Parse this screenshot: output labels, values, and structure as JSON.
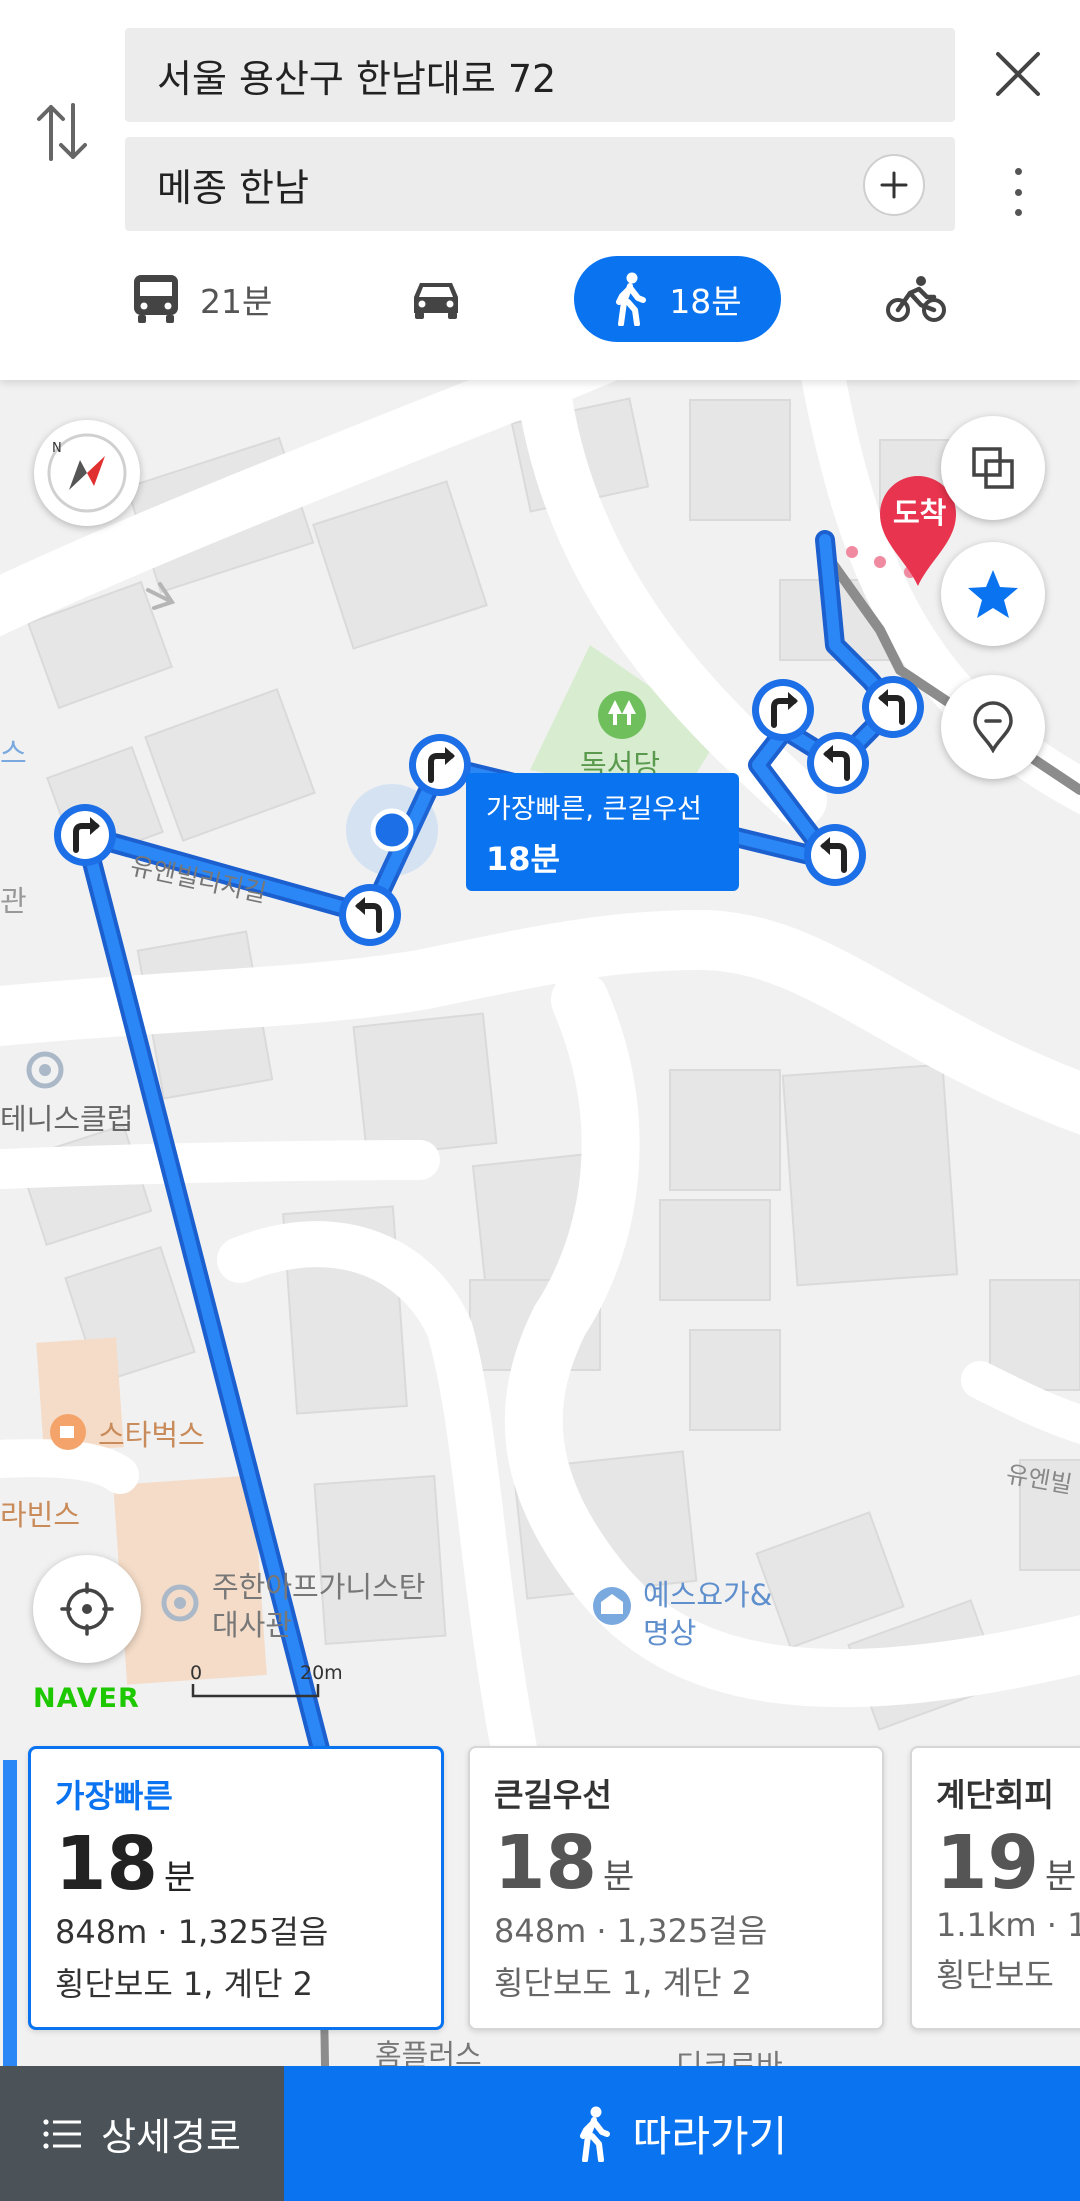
{
  "header": {
    "origin": "서울 용산구 한남대로 72",
    "destination": "메종 한남",
    "modes": [
      {
        "name": "bus",
        "label": "21분",
        "icon": "bus-icon"
      },
      {
        "name": "car",
        "label": "",
        "icon": "car-icon"
      },
      {
        "name": "walk",
        "label": "18분",
        "icon": "walk-icon",
        "selected": true
      },
      {
        "name": "bicycle",
        "label": "",
        "icon": "bicycle-icon"
      }
    ]
  },
  "map": {
    "destination_marker": "도착",
    "tooltip": {
      "title": "가장빠른, 큰길우선",
      "time": "18분"
    },
    "labels": {
      "park": "독서당",
      "street_1": "유엔빌리지길",
      "street_2": "유엔빌",
      "tennis": "테니스클럽",
      "starbucks": "스타벅스",
      "baskin": "라빈스",
      "embassy_line1": "주한아프가니스탄",
      "embassy_line2": "대사관",
      "yoga_line1": "예스요가&",
      "yoga_line2": "명상",
      "homeplus": "홈플러스",
      "clipped_left": "스",
      "clipped_left2": "관",
      "clipped_bottom": "디크로바"
    },
    "scale": {
      "start": "0",
      "end": "20m"
    },
    "logo": "NAVER"
  },
  "routes": [
    {
      "name": "가장빠른",
      "minutes": "18",
      "unit": "분",
      "distance_steps": "848m · 1,325걸음",
      "details": "횡단보도 1, 계단 2",
      "selected": true
    },
    {
      "name": "큰길우선",
      "minutes": "18",
      "unit": "분",
      "distance_steps": "848m · 1,325걸음",
      "details": "횡단보도 1, 계단 2",
      "selected": false
    },
    {
      "name": "계단회피",
      "minutes": "19",
      "unit": "분",
      "distance_steps": "1.1km · 1",
      "details": "횡단보도",
      "selected": false
    }
  ],
  "bottom": {
    "detail_label": "상세경로",
    "follow_label": "따라가기"
  },
  "colors": {
    "accent": "#0a73f0",
    "destination": "#e8344e",
    "park": "#d8ecd0",
    "logo": "#1ec800",
    "detail_bg": "#4b5358"
  }
}
